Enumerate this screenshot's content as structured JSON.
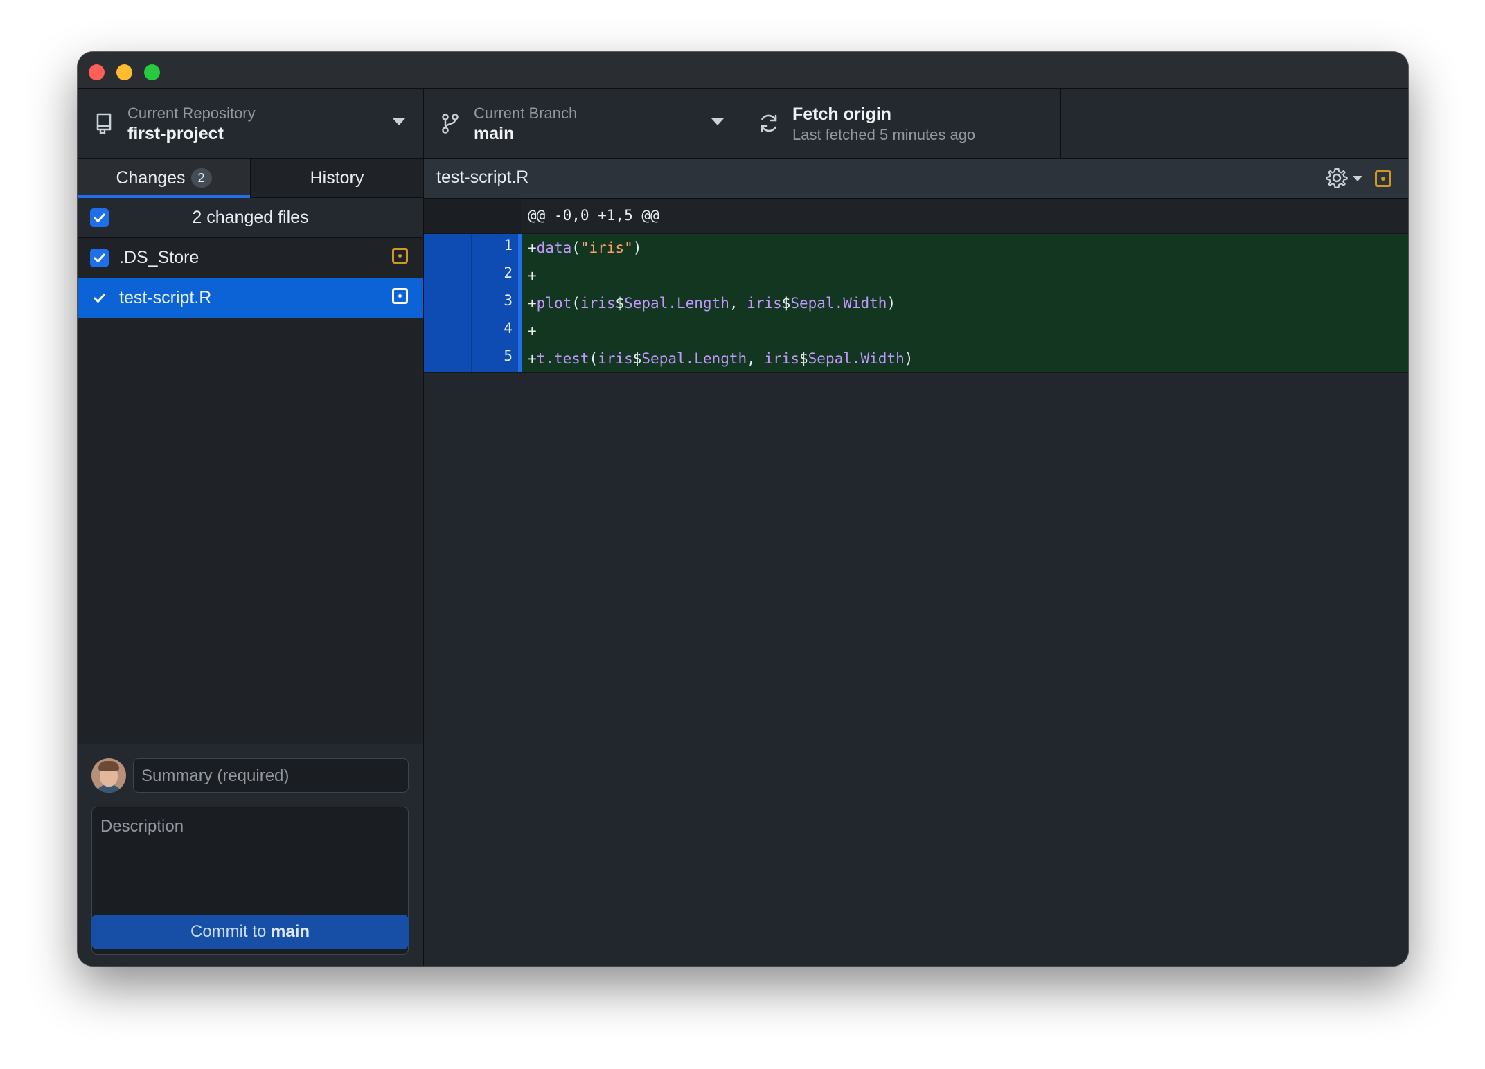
{
  "repository": {
    "label": "Current Repository",
    "name": "first-project"
  },
  "branch": {
    "label": "Current Branch",
    "name": "main"
  },
  "fetch": {
    "title": "Fetch origin",
    "status": "Last fetched 5 minutes ago"
  },
  "tabs": [
    {
      "label": "Changes",
      "count": "2"
    },
    {
      "label": "History"
    }
  ],
  "changes": {
    "summary": "2 changed files",
    "files": [
      {
        "name": ".DS_Store",
        "checked": true,
        "status_icon": "modified-file-icon"
      },
      {
        "name": "test-script.R",
        "checked": true,
        "status_icon": "modified-file-icon"
      }
    ]
  },
  "commit": {
    "summary_placeholder": "Summary (required)",
    "description_placeholder": "Description",
    "button_prefix": "Commit to ",
    "button_branch": "main"
  },
  "diff": {
    "file": "test-script.R",
    "hunk": "@@ -0,0 +1,5 @@",
    "lines": [
      {
        "num": "1",
        "text": "+data(\"iris\")"
      },
      {
        "num": "2",
        "text": "+"
      },
      {
        "num": "3",
        "text": "+plot(iris$Sepal.Length, iris$Sepal.Width)"
      },
      {
        "num": "4",
        "text": "+"
      },
      {
        "num": "5",
        "text": "+t.test(iris$Sepal.Length, iris$Sepal.Width)"
      }
    ]
  },
  "colors": {
    "accent": "#1f6feb",
    "added_bg": "#12361f",
    "modified": "#d29922",
    "selected_row": "#0b63d6"
  }
}
